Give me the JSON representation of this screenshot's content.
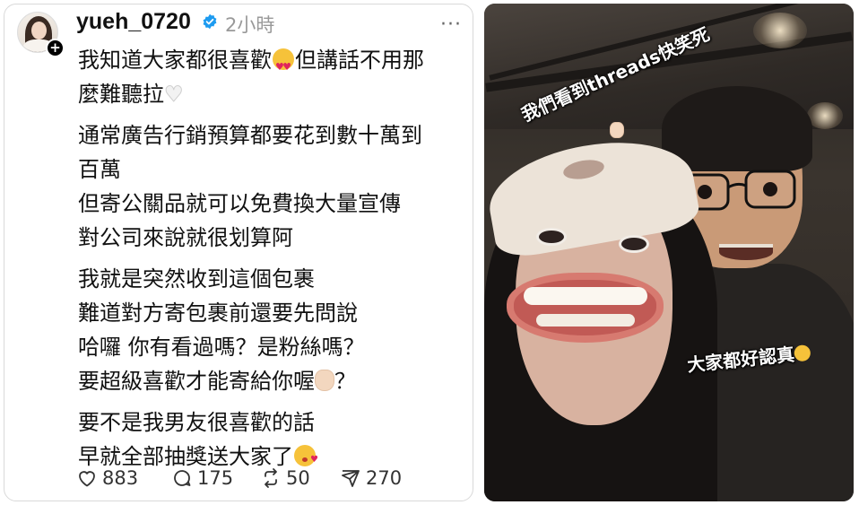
{
  "post": {
    "username": "yueh_0720",
    "timestamp": "2小時",
    "more_label": "···",
    "avatar_add_label": "+",
    "paragraphs": [
      {
        "lines": [
          {
            "before": "我知道大家都很喜歡",
            "emoji": "smiling-face-heart-eyes",
            "after": "但講話不用那"
          },
          {
            "before": "麼難聽拉",
            "emoji": "white-heart",
            "after": ""
          }
        ]
      },
      {
        "lines": [
          {
            "text": "通常廣告行銷預算都要花到數十萬到"
          },
          {
            "text": "百萬"
          },
          {
            "text": "但寄公關品就可以免費換大量宣傳"
          },
          {
            "text": "對公司來說就很划算阿"
          }
        ]
      },
      {
        "lines": [
          {
            "text": "我就是突然收到這個包裹"
          },
          {
            "text": "難道對方寄包裹前還要先問說"
          },
          {
            "text": "哈囉 你有看過嗎？是粉絲嗎？"
          },
          {
            "before": "要超級喜歡才能寄給你喔",
            "emoji": "ok-hand",
            "after": "？"
          }
        ]
      },
      {
        "lines": [
          {
            "text": "要不是我男友很喜歡的話"
          },
          {
            "before": "早就全部抽獎送大家了",
            "emoji": "face-blowing-kiss",
            "after": ""
          }
        ]
      }
    ],
    "actions": {
      "likes": "883",
      "replies": "175",
      "reposts": "50",
      "shares": "270"
    },
    "icons": {
      "like": "heart-icon",
      "reply": "comment-bubble-icon",
      "repost": "repost-icon",
      "share": "send-icon",
      "verified": "verified-badge-icon"
    },
    "colors": {
      "verified": "#1d9bf0",
      "timestamp": "#999999",
      "text": "#111111"
    }
  },
  "photo": {
    "sticker_top": "我們看到threads快笑死",
    "sticker_bottom": "大家都好認真"
  }
}
